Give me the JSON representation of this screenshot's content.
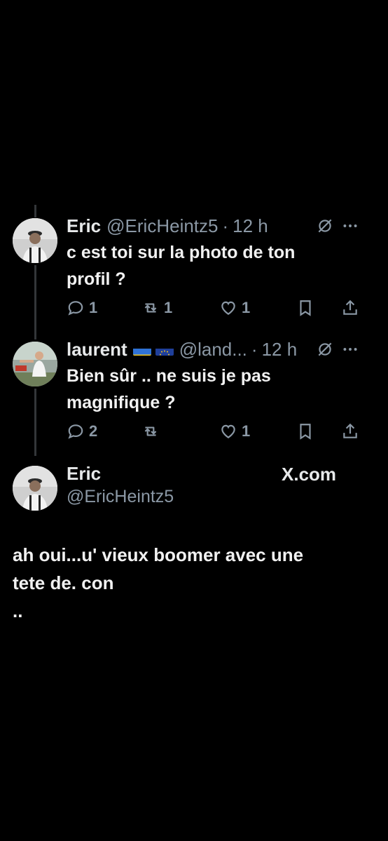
{
  "tweet1": {
    "name": "Eric",
    "handle": "@EricHeintz5",
    "separator": "·",
    "time": "12 h",
    "text_line1": "c est toi sur la photo de ton",
    "text_line2": "profil ?",
    "replies": "1",
    "retweets": "1",
    "likes": "1"
  },
  "tweet2": {
    "name": "laurent",
    "flags": [
      "ukraine-flag",
      "eu-flag"
    ],
    "handle": "@land...",
    "separator": "·",
    "time": "12 h",
    "text_line1": "Bien sûr .. ne suis je pas",
    "text_line2": "magnifique ?",
    "replies": "2",
    "retweets": "",
    "likes": "1"
  },
  "tweet3": {
    "name": "Eric",
    "handle": "@EricHeintz5",
    "brand": "X.com",
    "text_line1": "ah oui...u' vieux boomer avec une",
    "text_line2": "tete de. con",
    "text_line3": ".."
  },
  "colors": {
    "background": "#000000",
    "text": "#e7e9ea",
    "muted": "#8b98a5",
    "thread_line": "#333639"
  }
}
